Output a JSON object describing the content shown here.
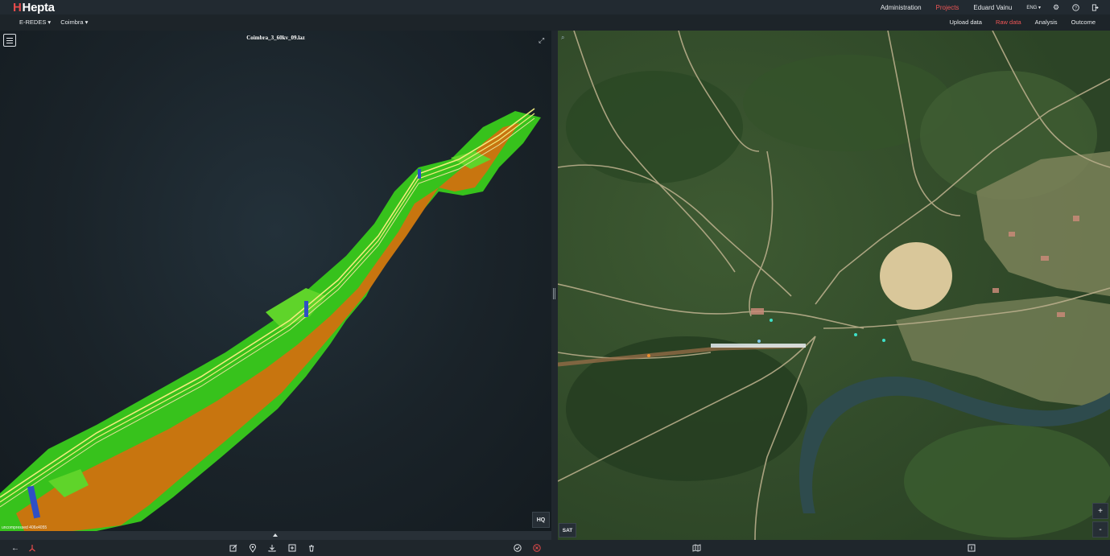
{
  "app": {
    "logo": "Hepta"
  },
  "topnav": {
    "administration": "Administration",
    "projects": "Projects",
    "user": "Eduard Vainu",
    "language": "ENG ▾",
    "icons": [
      "gear-icon",
      "help-icon",
      "logout-icon"
    ]
  },
  "breadcrumb": {
    "org": "E-REDES ▾",
    "project": "Coimbra ▾"
  },
  "subnav": {
    "upload": "Upload data",
    "raw": "Raw data",
    "analysis": "Analysis",
    "outcome": "Outcome"
  },
  "viewer": {
    "file_title": "Coimbra_3_60kv_09.laz",
    "hq_label": "HQ",
    "layer_label": "uncompressed 406x4055"
  },
  "map": {
    "sat_label": "SAT",
    "zoom_in": "+",
    "zoom_out": "-"
  },
  "colors": {
    "accent": "#f05656",
    "ground": "#c8750f",
    "vegetation": "#37c21c",
    "wire": "#f1ec7d",
    "pole": "#2f4fc6"
  }
}
